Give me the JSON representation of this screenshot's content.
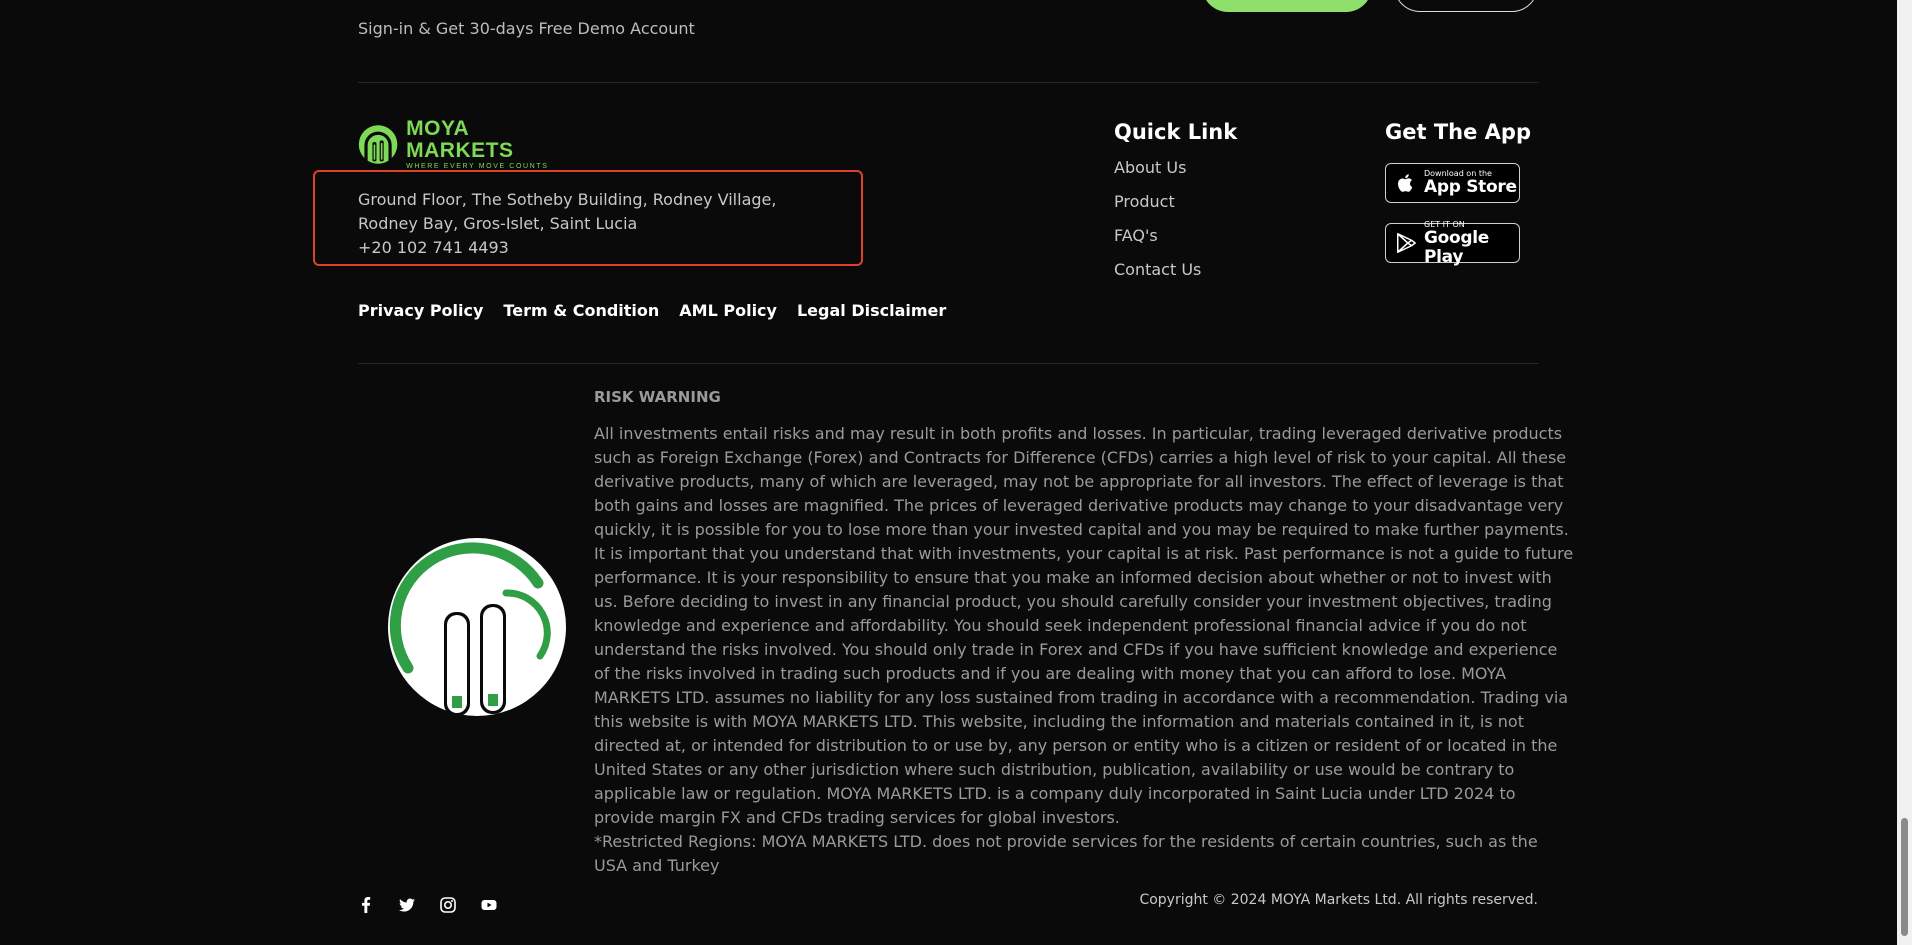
{
  "cta": {
    "text": "Sign-in & Get 30-days Free Demo Account"
  },
  "brand": {
    "name": "MOYA MARKETS",
    "tagline": "WHERE EVERY MOVE COUNTS",
    "accent": "#7ed957",
    "green_button": "#8fe06a"
  },
  "address": {
    "line1": "Ground Floor, The Sotheby Building, Rodney Village,",
    "line2": "Rodney Bay, Gros-Islet, Saint Lucia",
    "phone": "+20 102 741 4493"
  },
  "legal_links": [
    "Privacy Policy",
    "Term & Condition",
    "AML Policy",
    "Legal Disclaimer"
  ],
  "quick_links": {
    "title": "Quick Link",
    "items": [
      "About Us",
      "Product",
      "FAQ's",
      "Contact Us"
    ]
  },
  "get_app": {
    "title": "Get The App",
    "app_store": {
      "small": "Download on the",
      "large": "App Store",
      "icon": "apple-icon"
    },
    "google_play": {
      "small": "GET IT ON",
      "large": "Google Play",
      "icon": "google-play-icon"
    }
  },
  "risk": {
    "title": "RISK WARNING",
    "body": "All investments entail risks and may result in both profits and losses. In particular, trading leveraged derivative products such as Foreign Exchange (Forex) and Contracts for Difference (CFDs) carries a high level of risk to your capital. All these derivative products, many of which are leveraged, may not be appropriate for all investors. The effect of leverage is that both gains and losses are magnified. The prices of leveraged derivative products may change to your disadvantage very quickly, it is possible for you to lose more than your invested capital and you may be required to make further payments. It is important that you understand that with investments, your capital is at risk. Past performance is not a guide to future performance. It is your responsibility to ensure that you make an informed decision about whether or not to invest with us. Before deciding to invest in any financial product, you should carefully consider your investment objectives, trading knowledge and experience and affordability. You should seek independent professional financial advice if you do not understand the risks involved. You should only trade in Forex and CFDs if you have sufficient knowledge and experience of the risks involved in trading such products and if you are dealing with money that you can afford to lose. MOYA MARKETS LTD. assumes no liability for any loss sustained from trading in accordance with a recommendation. Trading via this website is with MOYA MARKETS LTD. This website, including the information and materials contained in it, is not directed at, or intended for distribution to or use by, any person or entity who is a citizen or resident of or located in the United States or any other jurisdiction where such distribution, publication, availability or use would be contrary to applicable law or regulation. MOYA MARKETS LTD. is a company duly incorporated in Saint Lucia under LTD 2024 to provide margin FX and CFDs trading services for global investors.",
    "restricted": "*Restricted Regions: MOYA MARKETS LTD. does not provide services for the residents of certain countries, such as the USA and Turkey"
  },
  "socials": [
    "facebook-icon",
    "twitter-icon",
    "instagram-icon",
    "youtube-icon"
  ],
  "copyright": "Copyright © 2024 MOYA Markets Ltd. All rights reserved."
}
